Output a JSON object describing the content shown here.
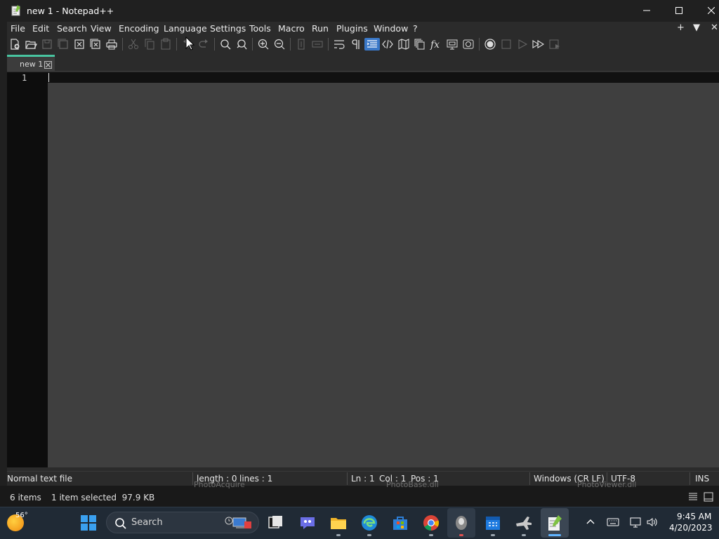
{
  "window": {
    "title": "new 1 - Notepad++",
    "icon": "notepadpp-icon",
    "controls": [
      "minimize-icon",
      "maximize-icon",
      "close-icon"
    ]
  },
  "menu": {
    "items": [
      "File",
      "Edit",
      "Search",
      "View",
      "Encoding",
      "Language",
      "Settings",
      "Tools",
      "Macro",
      "Run",
      "Plugins",
      "Window",
      "?"
    ],
    "right": [
      "+",
      "▼",
      "✕"
    ]
  },
  "toolbar": {
    "icons": [
      "new-file-icon",
      "open-icon",
      "save-icon",
      "save-all-icon",
      "close-icon",
      "close-all-icon",
      "print-icon",
      "cut-icon",
      "copy-icon",
      "paste-icon",
      "undo-icon",
      "redo-icon",
      "find-icon",
      "replace-icon",
      "zoom-in-icon",
      "zoom-out-icon",
      "sync-vertical-icon",
      "sync-horizontal-icon",
      "word-wrap-icon",
      "show-all-characters-icon",
      "indent-guide-icon",
      "language-icon",
      "document-map-icon",
      "document-list-icon",
      "function-list-icon",
      "folder-as-workspace-icon",
      "monitoring-icon",
      "record-macro-icon",
      "stop-recording-icon",
      "playback-macro-icon",
      "run-macro-multiple-icon",
      "save-macro-icon"
    ]
  },
  "tabs": [
    {
      "label": "new 1",
      "active": true
    }
  ],
  "editor": {
    "line_numbers": [
      "1"
    ],
    "content": ""
  },
  "statusbar": {
    "file_type": "Normal text file",
    "length": "length : 0",
    "lines": "lines : 1",
    "ln": "Ln : 1",
    "col": "Col : 1",
    "pos": "Pos : 1",
    "eol": "Windows (CR LF)",
    "encoding": "UTF-8",
    "mode": "INS"
  },
  "explorer": {
    "item_count": "6 items",
    "selection": "1 item selected  97.9 KB",
    "ghost_files": [
      "PhotoAcquire",
      "PhotoBase.dll",
      "PhotoViewer.dll"
    ]
  },
  "taskbar": {
    "weather_temp": "56°",
    "search_placeholder": "Search",
    "apps": [
      "start-icon",
      "task-view-icon",
      "chat-icon",
      "file-explorer-icon",
      "edge-icon",
      "store-icon",
      "chrome-icon",
      "app-icon",
      "calendar-icon",
      "plane-app-icon",
      "notepadpp-icon"
    ],
    "tray": [
      "chevron-up-icon",
      "keyboard-icon",
      "network-icon",
      "volume-icon"
    ],
    "time": "9:45 AM",
    "date": "4/20/2023"
  },
  "colors": {
    "accent_tab": "#48c4a0",
    "toolbar_active": "#3a78c8",
    "editor_bg": "#3f3f3f",
    "gutter_bg": "#0d0d0d",
    "taskbar_bg": "#202a35"
  }
}
